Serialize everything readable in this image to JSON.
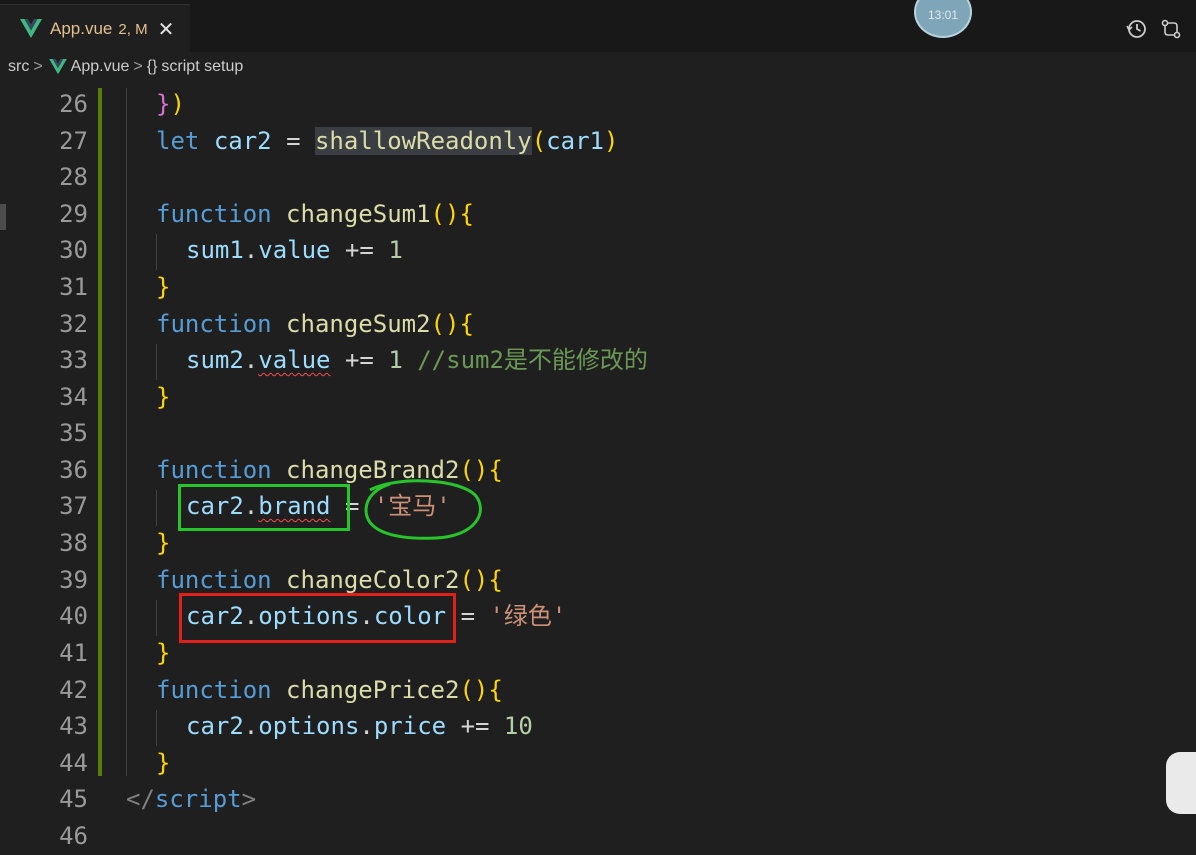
{
  "tab": {
    "filename": "App.vue",
    "status": "2, M",
    "close_glyph": "✕"
  },
  "avatar_time": "13:01",
  "breadcrumb": {
    "folder": "src",
    "file": "App.vue",
    "symbol_icon": "{}",
    "symbol": "script setup",
    "separator": ">"
  },
  "toolbar_icons": [
    "timeline-history-icon",
    "source-control-compare-icon"
  ],
  "colors": {
    "keyword": "#569cd6",
    "function": "#dcdcaa",
    "variable": "#9cdcfe",
    "string": "#ce9178",
    "comment": "#6a9955",
    "number": "#b5cea8",
    "annotation_green": "#27c42b",
    "annotation_red": "#e0201b"
  },
  "code": {
    "line_numbers": [
      "26",
      "27",
      "28",
      "29",
      "30",
      "31",
      "32",
      "33",
      "34",
      "35",
      "36",
      "37",
      "38",
      "39",
      "40",
      "41",
      "42",
      "43",
      "44",
      "45",
      "46"
    ],
    "l26": {
      "brace": "}",
      "paren": ")"
    },
    "l27": {
      "kw": "let",
      "name": "car2",
      "op": "=",
      "fn": "shallowReadonly",
      "arg": "car1"
    },
    "l29": {
      "kw": "function",
      "fn": "changeSum1",
      "sig": "(){"
    },
    "l30": {
      "obj": "sum1",
      "prop": "value",
      "op": "+=",
      "num": "1"
    },
    "l31": {
      "brace": "}"
    },
    "l32": {
      "kw": "function",
      "fn": "changeSum2",
      "sig": "(){"
    },
    "l33": {
      "obj": "sum2",
      "prop": "value",
      "op": "+=",
      "num": "1",
      "comment": "//sum2是不能修改的"
    },
    "l34": {
      "brace": "}"
    },
    "l36": {
      "kw": "function",
      "fn": "changeBrand2",
      "sig": "(){"
    },
    "l37": {
      "obj": "car2",
      "prop": "brand",
      "op": "=",
      "str": "'宝马'"
    },
    "l38": {
      "brace": "}"
    },
    "l39": {
      "kw": "function",
      "fn": "changeColor2",
      "sig": "(){"
    },
    "l40": {
      "obj": "car2",
      "mid": "options",
      "prop": "color",
      "op": "=",
      "str": "'绿色'"
    },
    "l41": {
      "brace": "}"
    },
    "l42": {
      "kw": "function",
      "fn": "changePrice2",
      "sig": "(){"
    },
    "l43": {
      "obj": "car2",
      "mid": "options",
      "prop": "price",
      "op": "+=",
      "num": "10"
    },
    "l44": {
      "brace": "}"
    },
    "l45": {
      "open": "</",
      "tag": "script",
      "close": ">"
    }
  }
}
